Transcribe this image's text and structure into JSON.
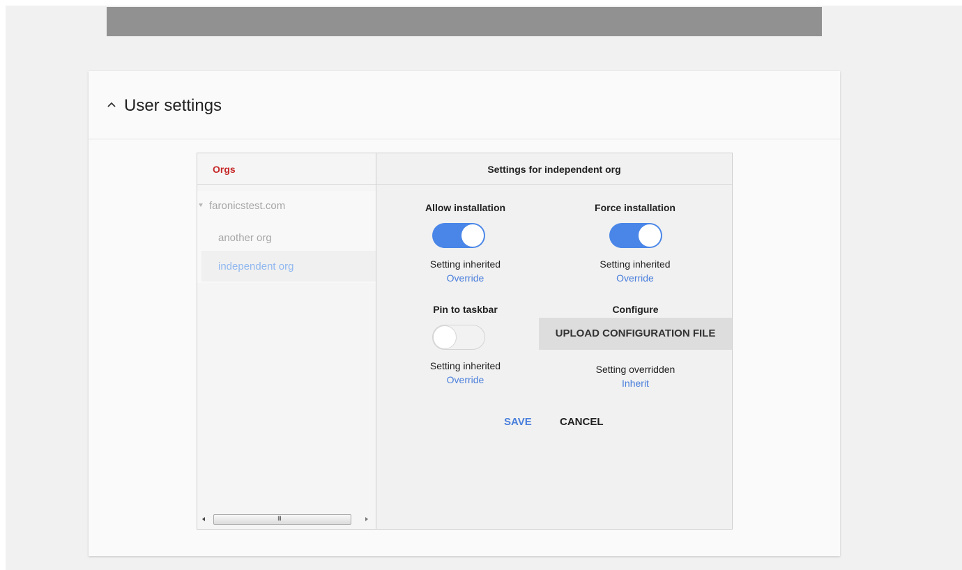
{
  "card": {
    "title": "User settings",
    "collapse_icon": "chevron-up-icon"
  },
  "orgs": {
    "title": "Orgs",
    "items": [
      {
        "label": "faronicstest.com",
        "expanded": true,
        "selected": false
      },
      {
        "label": "another org",
        "selected": false
      },
      {
        "label": "independent org",
        "selected": true
      }
    ],
    "scrollbar_grip": "III"
  },
  "settings": {
    "title": "Settings for independent org",
    "allow_installation": {
      "label": "Allow installation",
      "enabled": true,
      "status": "Setting inherited",
      "link": "Override"
    },
    "force_installation": {
      "label": "Force installation",
      "enabled": true,
      "status": "Setting inherited",
      "link": "Override"
    },
    "pin_to_taskbar": {
      "label": "Pin to taskbar",
      "enabled": false,
      "status": "Setting inherited",
      "link": "Override"
    },
    "configure": {
      "label": "Configure",
      "button": "UPLOAD CONFIGURATION FILE",
      "status": "Setting overridden",
      "link": "Inherit"
    },
    "actions": {
      "save": "SAVE",
      "cancel": "CANCEL"
    }
  },
  "colors": {
    "accent_blue": "#4a86e8",
    "link_blue": "#4a7fdc",
    "orgs_red": "#c62828",
    "selected_org": "#90b8f0"
  }
}
